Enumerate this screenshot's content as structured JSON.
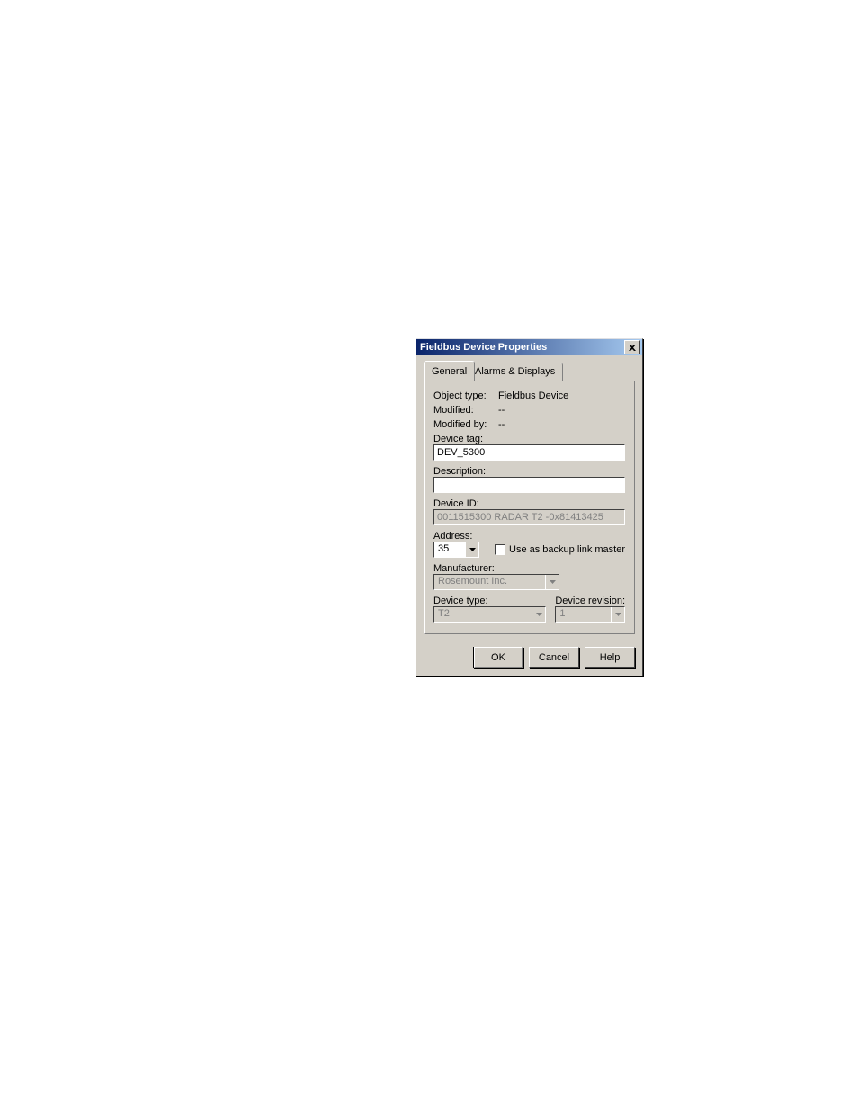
{
  "window_title": "Fieldbus Device Properties",
  "tabs": {
    "general": "General",
    "alarms": "Alarms & Displays"
  },
  "fields": {
    "object_type_label": "Object type:",
    "object_type_value": "Fieldbus Device",
    "modified_label": "Modified:",
    "modified_value": "--",
    "modified_by_label": "Modified by:",
    "modified_by_value": "--",
    "device_tag_label": "Device tag:",
    "device_tag_value": "DEV_5300",
    "description_label": "Description:",
    "description_value": "",
    "device_id_label": "Device ID:",
    "device_id_value": "0011515300 RADAR T2 -0x81413425",
    "address_label": "Address:",
    "address_value": "35",
    "backup_lm_label": "Use as backup link master",
    "manufacturer_label": "Manufacturer:",
    "manufacturer_value": "Rosemount Inc.",
    "device_type_label": "Device type:",
    "device_type_value": "T2",
    "device_rev_label": "Device revision:",
    "device_rev_value": "1"
  },
  "buttons": {
    "ok": "OK",
    "cancel": "Cancel",
    "help": "Help"
  }
}
